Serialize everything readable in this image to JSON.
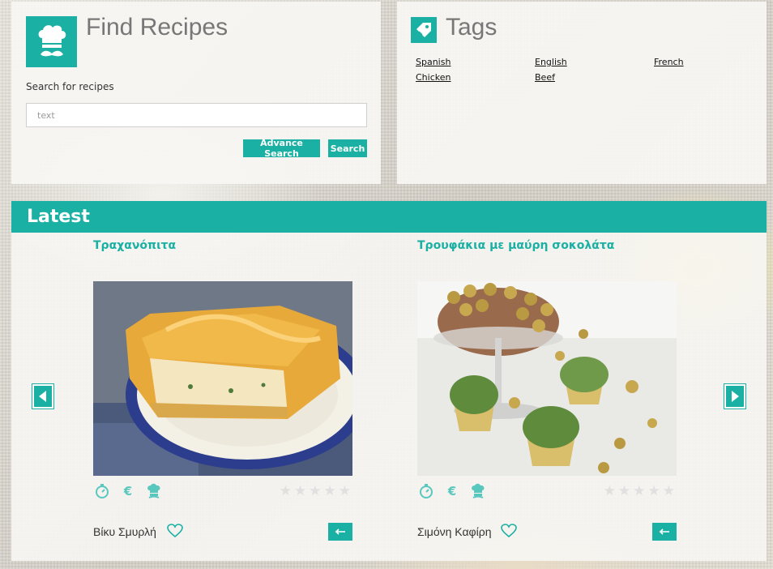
{
  "find": {
    "title": "Find Recipes",
    "search_label": "Search for recipes",
    "search_placeholder": "text",
    "advance_label": "Advance Search",
    "search_button": "Search"
  },
  "tags": {
    "title": "Tags",
    "items": [
      "Spanish",
      "English",
      "French",
      "Chicken",
      "Beef"
    ]
  },
  "latest": {
    "title": "Latest",
    "cards": [
      {
        "title": "Τραχανόπιτα",
        "author": "Βίκυ Σμυρλή",
        "rating": 0,
        "meta_icons": [
          "stopwatch-icon",
          "euro-icon",
          "chef-hat-icon"
        ]
      },
      {
        "title": "Τρουφάκια με μαύρη σοκολάτα",
        "author": "Σιμόνη Καφίρη",
        "rating": 0,
        "meta_icons": [
          "stopwatch-icon",
          "euro-icon",
          "chef-hat-icon"
        ]
      }
    ]
  },
  "colors": {
    "accent": "#1ab0a3",
    "accent_light": "#58c8be"
  }
}
